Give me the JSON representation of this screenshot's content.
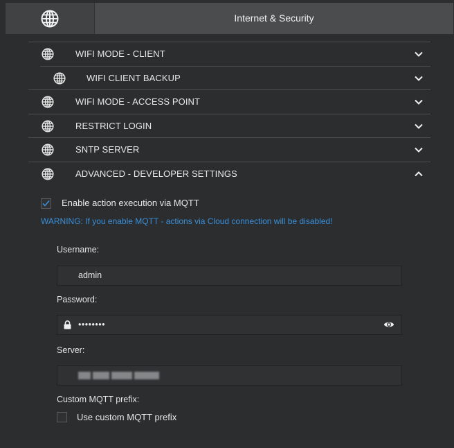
{
  "header": {
    "title": "Internet & Security",
    "icon": "globe-icon"
  },
  "sections": [
    {
      "label": "WIFI MODE - CLIENT",
      "icon": "globe-icon",
      "state": "collapsed"
    },
    {
      "label": "WIFI CLIENT BACKUP",
      "icon": "globe-icon",
      "state": "collapsed"
    },
    {
      "label": "WIFI MODE - ACCESS POINT",
      "icon": "globe-icon",
      "state": "collapsed"
    },
    {
      "label": "RESTRICT LOGIN",
      "icon": "globe-icon",
      "state": "collapsed"
    },
    {
      "label": "SNTP SERVER",
      "icon": "globe-icon",
      "state": "collapsed"
    },
    {
      "label": "ADVANCED - DEVELOPER SETTINGS",
      "icon": "globe-icon",
      "state": "expanded"
    }
  ],
  "advanced": {
    "mqtt_enable_label": "Enable action execution via MQTT",
    "mqtt_enable_checked": true,
    "warning": "WARNING: If you enable MQTT - actions via Cloud connection will be disabled!",
    "username_label": "Username:",
    "username_value": "admin",
    "password_label": "Password:",
    "password_value": "••••••••",
    "server_label": "Server:",
    "custom_prefix_label": "Custom MQTT prefix:",
    "use_custom_prefix_label": "Use custom MQTT prefix",
    "use_custom_prefix_checked": false
  },
  "colors": {
    "background": "#2b2d2f",
    "header": "#4a4c4e",
    "accent": "#3b8fd9"
  }
}
